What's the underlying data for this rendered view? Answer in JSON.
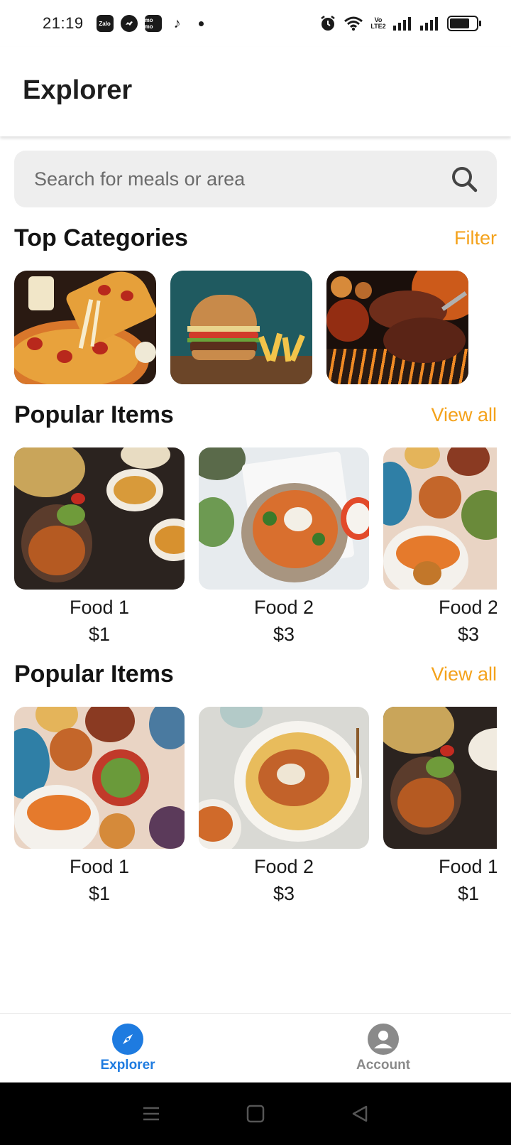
{
  "status_bar": {
    "time": "21:19",
    "apps": [
      {
        "name": "zalo-icon",
        "label": "Zalo"
      },
      {
        "name": "messenger-icon",
        "label": ""
      },
      {
        "name": "momo-icon",
        "label": "mo mo"
      },
      {
        "name": "tiktok-icon",
        "label": "♪"
      }
    ],
    "volte_label": "Vo LTE2",
    "battery_percent": 75
  },
  "header": {
    "title": "Explorer"
  },
  "search": {
    "placeholder": "Search for meals or area"
  },
  "categories_section": {
    "title": "Top Categories",
    "action_label": "Filter",
    "items": [
      {
        "name": "pizza"
      },
      {
        "name": "burger"
      },
      {
        "name": "steak"
      }
    ]
  },
  "popular_sections": [
    {
      "title": "Popular Items",
      "action_label": "View all",
      "items": [
        {
          "name": "Food 1",
          "price": "$1"
        },
        {
          "name": "Food 2",
          "price": "$3"
        },
        {
          "name": "Food 2",
          "price": "$3"
        }
      ]
    },
    {
      "title": "Popular Items",
      "action_label": "View all",
      "items": [
        {
          "name": "Food 1",
          "price": "$1"
        },
        {
          "name": "Food 2",
          "price": "$3"
        },
        {
          "name": "Food 1",
          "price": "$1"
        }
      ]
    }
  ],
  "bottom_nav": {
    "items": [
      {
        "label": "Explorer",
        "icon": "compass-icon",
        "active": true
      },
      {
        "label": "Account",
        "icon": "account-icon",
        "active": false
      }
    ]
  },
  "colors": {
    "accent": "#f4a21b",
    "nav_active": "#1e7be0",
    "nav_inactive": "#888888"
  }
}
